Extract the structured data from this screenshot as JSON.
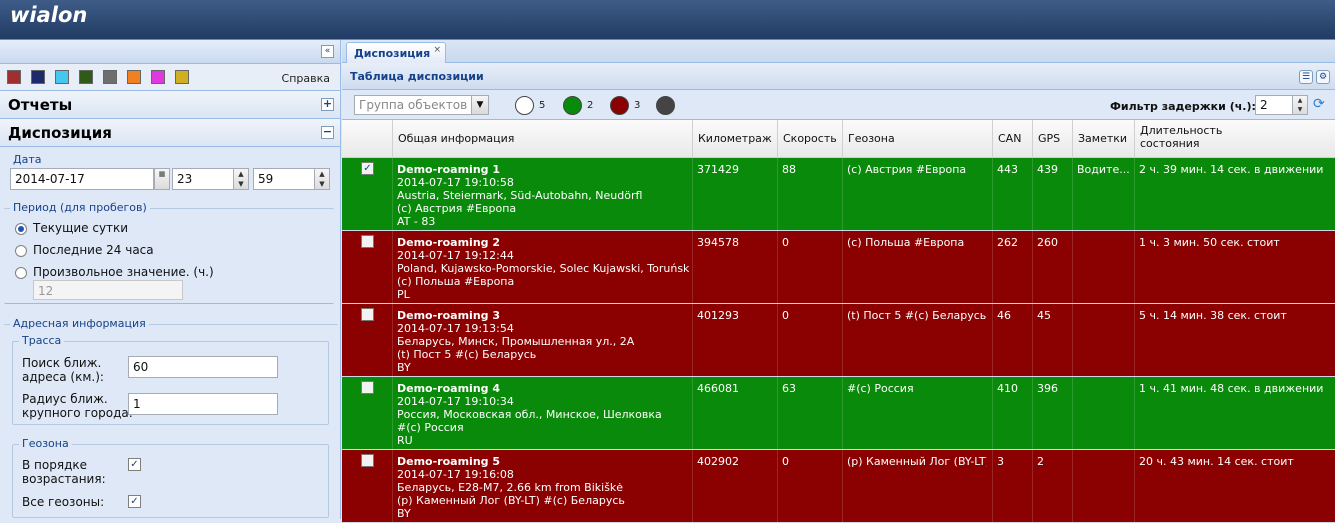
{
  "app": {
    "logo": "wialon"
  },
  "sidebar": {
    "collapse_icon": "«",
    "colors": [
      "#a03030",
      "#1d2a6b",
      "#45c8f0",
      "#2f5a1a",
      "#6e6e6e",
      "#f08020",
      "#e038e0",
      "#d0b020"
    ],
    "help": "Справка",
    "reports": {
      "title": "Отчеты",
      "toggle": "+"
    },
    "disposition": {
      "title": "Диспозиция",
      "toggle": "−"
    },
    "date": {
      "label": "Дата",
      "value": "2014-07-17",
      "hour": "23",
      "minute": "59"
    },
    "period": {
      "legend": "Период (для пробегов)",
      "options": [
        "Текущие сутки",
        "Последние 24 часа",
        "Произвольное значение. (ч.)"
      ],
      "custom_value": "12"
    },
    "address": {
      "legend": "Адресная информация",
      "route_legend": "Трасса",
      "search_label_1": "Поиск ближ.",
      "search_label_2": "адреса (км.):",
      "search_value": "60",
      "radius_label_1": "Радиус ближ.",
      "radius_label_2": "крупного города:",
      "radius_value": "1",
      "geo_legend": "Геозона",
      "asc_label_1": "В порядке",
      "asc_label_2": "возрастания:",
      "all_label": "Все геозоны:"
    }
  },
  "main": {
    "tab": {
      "label": "Диспозиция",
      "close": "×"
    },
    "panel_title": "Таблица диспозиции",
    "toolbar": {
      "group_placeholder": "Группа объектов",
      "counts": [
        {
          "color": "#ffffff",
          "count": "5"
        },
        {
          "color": "#0a8a0a",
          "count": "2"
        },
        {
          "color": "#8b0000",
          "count": "3"
        },
        {
          "color": "#444444",
          "count": ""
        }
      ],
      "delay_filter_label": "Фильтр задержки (ч.):",
      "delay_filter_value": "2"
    },
    "columns": [
      "Общая информация",
      "Километраж",
      "Скорость",
      "Геозона",
      "CAN",
      "GPS",
      "Заметки",
      "Длительность",
      "состояния"
    ],
    "rows": [
      {
        "status": "green",
        "checked": "✓",
        "name": "Demo-roaming 1",
        "time": "2014-07-17 19:10:58",
        "address": "Austria, Steiermark, Süd-Autobahn, Neudörfl",
        "zone": "(c) Австрия #Европа",
        "country": "AT - 83",
        "mileage": "371429",
        "speed": "88",
        "geozone": "(c) Австрия #Европа",
        "can": "443",
        "gps": "439",
        "notes": "Водите...",
        "duration": "2 ч. 39 мин. 14 сек. в движении"
      },
      {
        "status": "red",
        "checked": "",
        "name": "Demo-roaming 2",
        "time": "2014-07-17 19:12:44",
        "address": "Poland, Kujawsko-Pomorskie, Solec Kujawski, Toruńska",
        "zone": "(c) Польша #Европа",
        "country": "PL",
        "mileage": "394578",
        "speed": "0",
        "geozone": "(c) Польша #Европа",
        "can": "262",
        "gps": "260",
        "notes": "",
        "duration": "1 ч. 3 мин. 50 сек. стоит"
      },
      {
        "status": "red",
        "checked": "",
        "name": "Demo-roaming 3",
        "time": "2014-07-17 19:13:54",
        "address": "Беларусь, Минск, Промышленная ул., 2А",
        "zone": "(t) Пост 5 #(c) Беларусь",
        "country": "BY",
        "mileage": "401293",
        "speed": "0",
        "geozone": "(t) Пост 5 #(c) Беларусь",
        "can": "46",
        "gps": "45",
        "notes": "",
        "duration": "5 ч. 14 мин. 38 сек. стоит"
      },
      {
        "status": "green",
        "checked": "",
        "name": "Demo-roaming 4",
        "time": "2014-07-17 19:10:34",
        "address": "Россия, Московская обл., Минское, Шелковка",
        "zone": "#(c) Россия",
        "country": "RU",
        "mileage": "466081",
        "speed": "63",
        "geozone": "#(c) Россия",
        "can": "410",
        "gps": "396",
        "notes": "",
        "duration": "1 ч. 41 мин. 48 сек. в движении"
      },
      {
        "status": "red",
        "checked": "",
        "name": "Demo-roaming 5",
        "time": "2014-07-17 19:16:08",
        "address": "Беларусь, E28-M7, 2.66 km from Bikiškė",
        "zone": "(p) Каменный Лог (BY-LT) #(c) Беларусь",
        "country": "BY",
        "mileage": "402902",
        "speed": "0",
        "geozone": "(p) Каменный Лог (BY-LT)...",
        "can": "3",
        "gps": "2",
        "notes": "",
        "duration": "20 ч. 43 мин. 14 сек. стоит"
      }
    ]
  }
}
